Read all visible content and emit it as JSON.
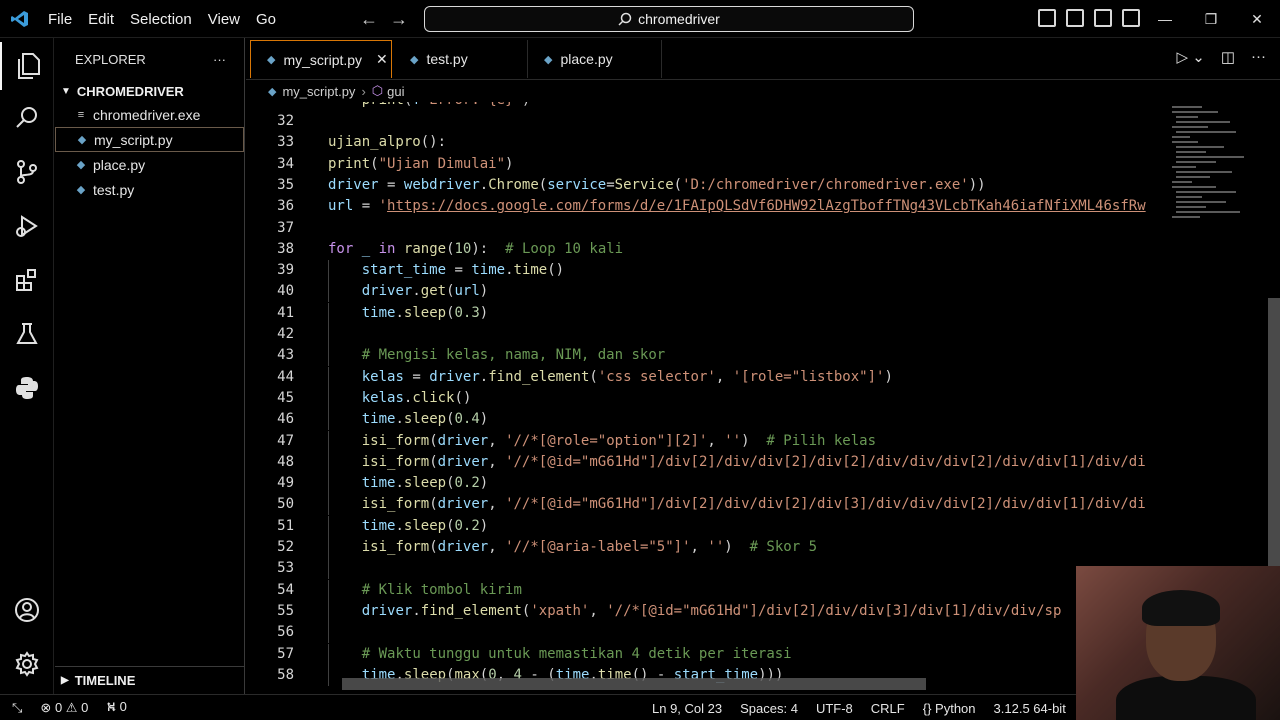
{
  "menu": [
    "File",
    "Edit",
    "Selection",
    "View",
    "Go"
  ],
  "search": {
    "text": "chromedriver"
  },
  "sidebar": {
    "title": "EXPLORER",
    "more": "···",
    "folder": "CHROMEDRIVER",
    "files": [
      {
        "name": "chromedriver.exe",
        "icon": "≡"
      },
      {
        "name": "my_script.py",
        "icon": "◆"
      },
      {
        "name": "place.py",
        "icon": "◆"
      },
      {
        "name": "test.py",
        "icon": "◆"
      }
    ],
    "timeline": "TIMELINE"
  },
  "tabs": [
    {
      "label": "my_script.py",
      "close": "✕"
    },
    {
      "label": "test.py"
    },
    {
      "label": "place.py"
    }
  ],
  "breadcrumb": {
    "file": "my_script.py",
    "sep": "›",
    "symbol": "gui"
  },
  "code": {
    "partial_top": "    print(f\"Error: {e}\")",
    "lines": [
      {
        "n": "32",
        "t": ""
      },
      {
        "n": "33",
        "t": "ujian_alpro():"
      },
      {
        "n": "34",
        "t": "print(\"Ujian Dimulai\")"
      },
      {
        "n": "35",
        "t": "driver = webdriver.Chrome(service=Service('D:/chromedriver/chromedriver.exe'))"
      },
      {
        "n": "36",
        "t": "url = 'https://docs.google.com/forms/d/e/1FAIpQLSdVf6DHW92lAzgTboffTNg43VLcbTKah46iafNfiXML46sfRw"
      },
      {
        "n": "37",
        "t": ""
      },
      {
        "n": "38",
        "t": "for _ in range(10):  # Loop 10 kali"
      },
      {
        "n": "39",
        "t": "    start_time = time.time()"
      },
      {
        "n": "40",
        "t": "    driver.get(url)"
      },
      {
        "n": "41",
        "t": "    time.sleep(0.3)"
      },
      {
        "n": "42",
        "t": ""
      },
      {
        "n": "43",
        "t": "    # Mengisi kelas, nama, NIM, dan skor"
      },
      {
        "n": "44",
        "t": "    kelas = driver.find_element('css selector', '[role=\"listbox\"]')"
      },
      {
        "n": "45",
        "t": "    kelas.click()"
      },
      {
        "n": "46",
        "t": "    time.sleep(0.4)"
      },
      {
        "n": "47",
        "t": "    isi_form(driver, '//*[@role=\"option\"][2]', '')  # Pilih kelas"
      },
      {
        "n": "48",
        "t": "    isi_form(driver, '//*[@id=\"mG61Hd\"]/div[2]/div/div[2]/div[2]/div/div/div[2]/div/div[1]/div/di"
      },
      {
        "n": "49",
        "t": "    time.sleep(0.2)"
      },
      {
        "n": "50",
        "t": "    isi_form(driver, '//*[@id=\"mG61Hd\"]/div[2]/div/div[2]/div[3]/div/div/div[2]/div/div[1]/div/di"
      },
      {
        "n": "51",
        "t": "    time.sleep(0.2)"
      },
      {
        "n": "52",
        "t": "    isi_form(driver, '//*[@aria-label=\"5\"]', '')  # Skor 5"
      },
      {
        "n": "53",
        "t": ""
      },
      {
        "n": "54",
        "t": "    # Klik tombol kirim"
      },
      {
        "n": "55",
        "t": "    driver.find_element('xpath', '//*[@id=\"mG61Hd\"]/div[2]/div/div[3]/div[1]/div/div/sp"
      },
      {
        "n": "56",
        "t": ""
      },
      {
        "n": "57",
        "t": "    # Waktu tunggu untuk memastikan 4 detik per iterasi"
      },
      {
        "n": "58",
        "t": "    time.sleep(max(0, 4 - (time.time() - start_time)))"
      }
    ]
  },
  "statusbar": {
    "errors": "0",
    "warnings": "0",
    "ports": "0",
    "position": "Ln 9, Col 23",
    "spaces": "Spaces: 4",
    "encoding": "UTF-8",
    "eol": "CRLF",
    "language": "Python",
    "interpreter": "3.12.5 64-bit"
  },
  "colors": {
    "accent": "#d97706",
    "background": "#000000"
  }
}
